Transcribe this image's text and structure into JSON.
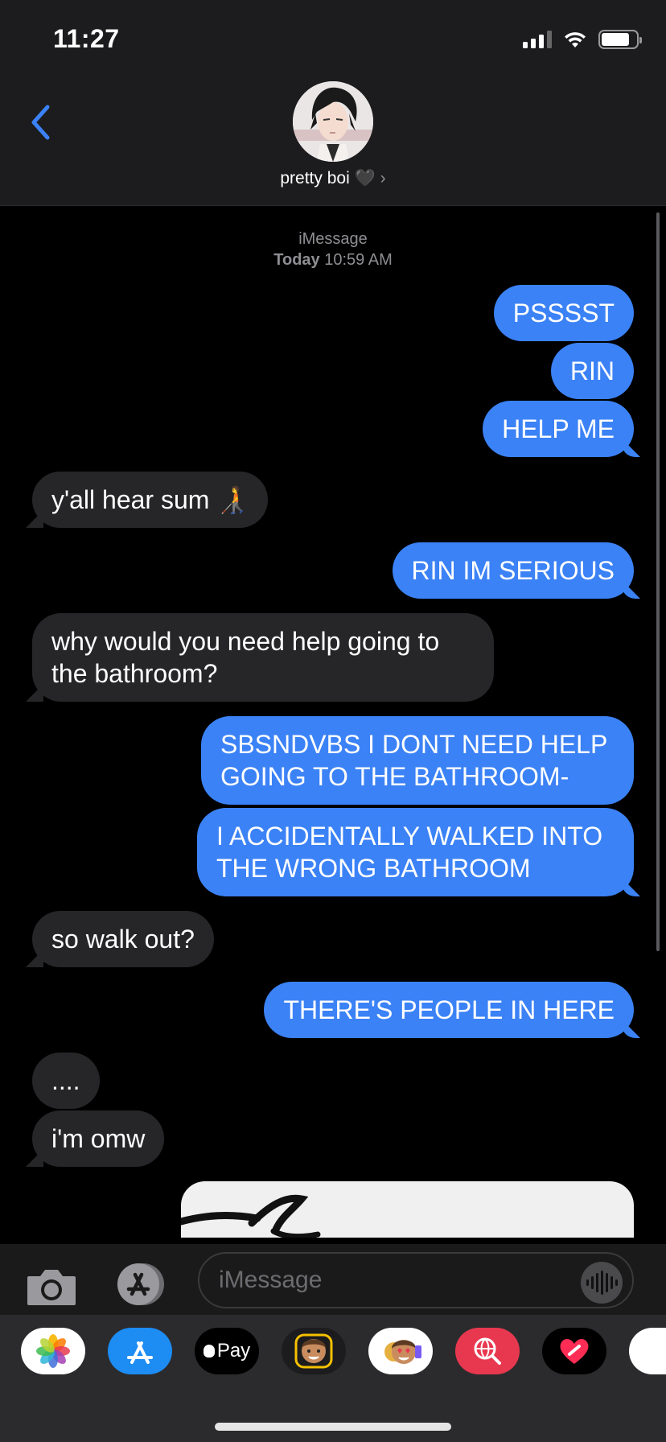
{
  "status_bar": {
    "time": "11:27",
    "signal_bars": 3,
    "battery_level": 0.8
  },
  "header": {
    "contact_name": "pretty boi",
    "heart": "🖤",
    "chevron": "›",
    "back_icon": "chevron-left-icon",
    "accent_color": "#3b82f6"
  },
  "conversation": {
    "service": "iMessage",
    "timestamp_prefix": "Today",
    "timestamp_time": "10:59 AM",
    "messages": [
      {
        "side": "sent",
        "text": "PSSSST"
      },
      {
        "side": "sent",
        "text": "RIN"
      },
      {
        "side": "sent",
        "text": "HELP ME"
      },
      {
        "side": "received",
        "text": "y'all hear sum 🧑‍🦯"
      },
      {
        "side": "sent",
        "text": "RIN IM SERIOUS"
      },
      {
        "side": "received",
        "text": "why would you need help going to the bathroom?"
      },
      {
        "side": "sent",
        "text": "SBSNDVBS I DONT NEED HELP GOING TO THE BATHROOM-"
      },
      {
        "side": "sent",
        "text": "I ACCIDENTALLY WALKED INTO THE WRONG BATHROOM"
      },
      {
        "side": "received",
        "text": "so walk out?"
      },
      {
        "side": "sent",
        "text": "THERE'S PEOPLE IN HERE"
      },
      {
        "side": "received",
        "text": "...."
      },
      {
        "side": "received",
        "text": "i'm omw"
      }
    ]
  },
  "input": {
    "placeholder": "iMessage"
  },
  "app_drawer": {
    "apps": [
      {
        "name": "photos-app-icon"
      },
      {
        "name": "app-store-app-icon"
      },
      {
        "name": "apple-pay-app-icon",
        "label": "Pay"
      },
      {
        "name": "memoji-app-icon"
      },
      {
        "name": "memoji-stickers-app-icon"
      },
      {
        "name": "images-search-app-icon"
      },
      {
        "name": "digital-touch-app-icon"
      },
      {
        "name": "more-apps-icon"
      }
    ]
  }
}
